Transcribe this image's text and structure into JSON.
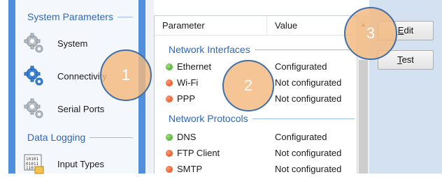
{
  "sidebar": {
    "sections": [
      {
        "title": "System Parameters"
      },
      {
        "title": "Data Logging"
      }
    ],
    "items": [
      {
        "label": "System",
        "icon": "gear-icon"
      },
      {
        "label": "Connectivity",
        "icon": "gear-icon",
        "selected": true
      },
      {
        "label": "Serial Ports",
        "icon": "gear-icon"
      },
      {
        "label": "Input Types",
        "icon": "binary-data-icon"
      }
    ]
  },
  "list": {
    "columns": [
      "Parameter",
      "Value"
    ],
    "groups": [
      {
        "title": "Network Interfaces",
        "rows": [
          {
            "name": "Ethernet",
            "value": "Configurated",
            "status": "green"
          },
          {
            "name": "Wi-Fi",
            "value": "Not configurated",
            "status": "red"
          },
          {
            "name": "PPP",
            "value": "Not configurated",
            "status": "red"
          }
        ]
      },
      {
        "title": "Network Protocols",
        "rows": [
          {
            "name": "DNS",
            "value": "Configurated",
            "status": "green"
          },
          {
            "name": "FTP Client",
            "value": "Not configurated",
            "status": "red"
          },
          {
            "name": "SMTP",
            "value": "Not configurated",
            "status": "red"
          }
        ]
      }
    ]
  },
  "buttons": {
    "edit": {
      "label": "Edit"
    },
    "test": {
      "label": "Test"
    }
  },
  "annotations": [
    {
      "label": "1"
    },
    {
      "label": "2"
    },
    {
      "label": "3"
    }
  ],
  "colors": {
    "accent": "#4f8fdd",
    "group_title": "#2f67b8",
    "status_green": "#2f9e1c",
    "status_red": "#e0401a",
    "badge_fill": "#f4b87e",
    "badge_border": "#3e6ea8"
  }
}
